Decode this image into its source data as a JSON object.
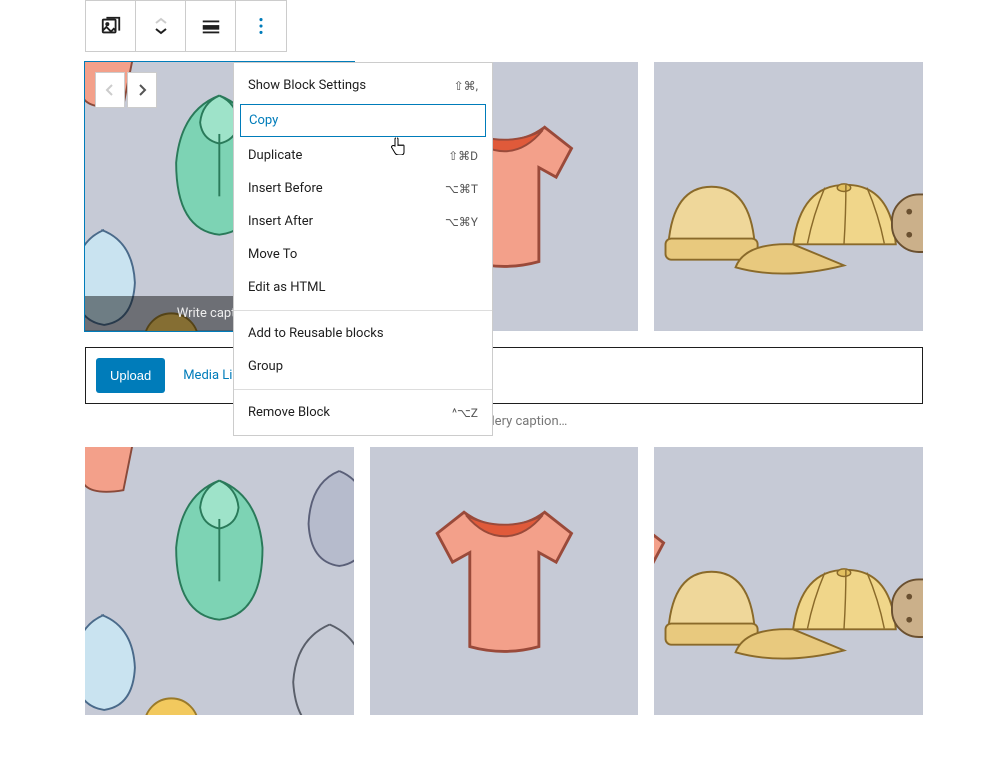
{
  "toolbar": {
    "block": "gallery-block",
    "alignment": "align-center"
  },
  "menu": {
    "show_settings": {
      "label": "Show Block Settings",
      "shortcut": "⇧⌘,"
    },
    "copy": {
      "label": "Copy"
    },
    "duplicate": {
      "label": "Duplicate",
      "shortcut": "⇧⌘D"
    },
    "insert_before": {
      "label": "Insert Before",
      "shortcut": "⌥⌘T"
    },
    "insert_after": {
      "label": "Insert After",
      "shortcut": "⌥⌘Y"
    },
    "move_to": {
      "label": "Move To"
    },
    "edit_html": {
      "label": "Edit as HTML"
    },
    "reusable": {
      "label": "Add to Reusable blocks"
    },
    "group": {
      "label": "Group"
    },
    "remove": {
      "label": "Remove Block",
      "shortcut": "^⌥Z"
    }
  },
  "selected_image": {
    "caption_placeholder": "Write caption…"
  },
  "media_panel": {
    "upload": "Upload",
    "library": "Media Library"
  },
  "gallery_caption_placeholder": "Write gallery caption…"
}
